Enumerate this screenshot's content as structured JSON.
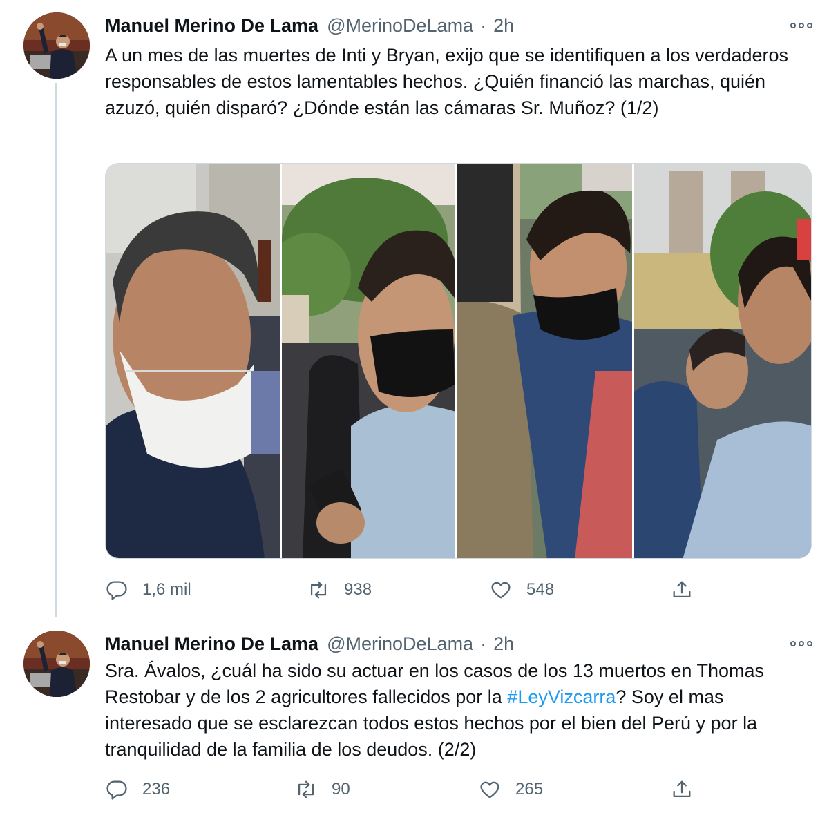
{
  "tweets": [
    {
      "author_name": "Manuel Merino De Lama",
      "handle": "@MerinoDeLama",
      "separator": "·",
      "time": "2h",
      "text": "A un mes de las muertes de Inti y Bryan, exijo que se identifiquen a los verdaderos responsables de estos lamentables hechos. ¿Quién financió las marchas, quién azuzó, quién disparó? ¿Dónde están las cámaras Sr. Muñoz? (1/2)",
      "replies": "1,6 mil",
      "retweets": "938",
      "likes": "548"
    },
    {
      "author_name": "Manuel Merino De Lama",
      "handle": "@MerinoDeLama",
      "separator": "·",
      "time": "2h",
      "text_before": "Sra. Ávalos, ¿cuál ha sido su actuar en los casos de los 13 muertos en Thomas Restobar y de los 2 agricultores fallecidos por la ",
      "hashtag": "#LeyVizcarra",
      "text_after": "? Soy el mas interesado que se esclarezcan todos estos hechos por el bien del Perú y por la tranquilidad de la familia de los deudos. (2/2)",
      "replies": "236",
      "retweets": "90",
      "likes": "265"
    }
  ],
  "icons": {
    "more": "more-icon",
    "reply": "reply-icon",
    "retweet": "retweet-icon",
    "like": "like-icon",
    "share": "share-icon"
  },
  "colors": {
    "text": "#0f1419",
    "secondary": "#536471",
    "link": "#1d9bf0",
    "thread_line": "#cfd9de"
  }
}
